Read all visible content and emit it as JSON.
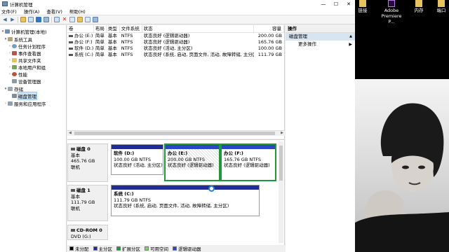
{
  "window": {
    "title": "计算机管理",
    "controls": {
      "minimize": "—",
      "maximize": "☐",
      "close": "✕"
    }
  },
  "menu": [
    "文件(F)",
    "操作(A)",
    "查看(V)",
    "帮助(H)"
  ],
  "tree": {
    "root": "计算机管理(本地)",
    "system_tools": "系统工具",
    "task_scheduler": "任务计划程序",
    "event_viewer": "事件查看器",
    "shared_folders": "共享文件夹",
    "local_users": "本地用户和组",
    "performance": "性能",
    "device_manager": "设备管理器",
    "storage": "存储",
    "disk_management": "磁盘管理",
    "services": "服务和应用程序"
  },
  "volumes": {
    "columns": [
      "卷",
      "布局",
      "类型",
      "文件系统",
      "状态",
      "容量"
    ],
    "rows": [
      {
        "name": "办公 (E:)",
        "layout": "简单",
        "type": "基本",
        "fs": "NTFS",
        "status": "状态良好 (逻辑驱动器)",
        "capacity": "200.00 GB"
      },
      {
        "name": "办公 (F:)",
        "layout": "简单",
        "type": "基本",
        "fs": "NTFS",
        "status": "状态良好 (逻辑驱动器)",
        "capacity": "165.76 GB"
      },
      {
        "name": "软件 (D:)",
        "layout": "简单",
        "type": "基本",
        "fs": "NTFS",
        "status": "状态良好 (活动, 主分区)",
        "capacity": "100.00 GB"
      },
      {
        "name": "系统 (C:)",
        "layout": "简单",
        "type": "基本",
        "fs": "NTFS",
        "status": "状态良好 (系统, 启动, 页面文件, 活动, 故障转储, 主分区)",
        "capacity": "111.79 GB"
      }
    ]
  },
  "disks": {
    "disk0": {
      "name": "磁盘 0",
      "type": "基本",
      "size": "465.76 GB",
      "state": "联机",
      "partitions": [
        {
          "name": "软件 (D:)",
          "size": "100.00 GB NTFS",
          "status": "状态良好 (活动, 主分区)"
        },
        {
          "name": "办公 (E:)",
          "size": "200.00 GB NTFS",
          "status": "状态良好 (逻辑驱动器)"
        },
        {
          "name": "办公 (F:)",
          "size": "165.76 GB NTFS",
          "status": "状态良好 (逻辑驱动器)"
        }
      ]
    },
    "disk1": {
      "name": "磁盘 1",
      "type": "基本",
      "size": "111.79 GB",
      "state": "联机",
      "partitions": [
        {
          "name": "系统 (C:)",
          "size": "111.79 GB NTFS",
          "status": "状态良好 (系统, 启动, 页面文件, 活动, 故障转储, 主分区)"
        }
      ]
    },
    "cdrom0": {
      "name": "CD-ROM 0",
      "type": "DVD (G:)"
    }
  },
  "legend": [
    {
      "label": "未分配",
      "color": "#000000"
    },
    {
      "label": "主分区",
      "color": "#1f2b9b"
    },
    {
      "label": "扩展分区",
      "color": "#1b9a3a"
    },
    {
      "label": "可用空间",
      "color": "#7fd36a"
    },
    {
      "label": "逻辑驱动器",
      "color": "#2b47c4"
    }
  ],
  "actions": {
    "header": "操作",
    "section": "磁盘管理",
    "more": "更多操作"
  },
  "desktop": {
    "icons": [
      {
        "label": "链接",
        "icon": "link-icon"
      },
      {
        "label": "Adobe Premiere P...",
        "icon": "premiere-icon"
      },
      {
        "label": "内存",
        "icon": "folder-icon"
      },
      {
        "label": "端口",
        "icon": "folder-icon"
      }
    ],
    "wallpaper": "black-and-white-portrait-photo"
  }
}
